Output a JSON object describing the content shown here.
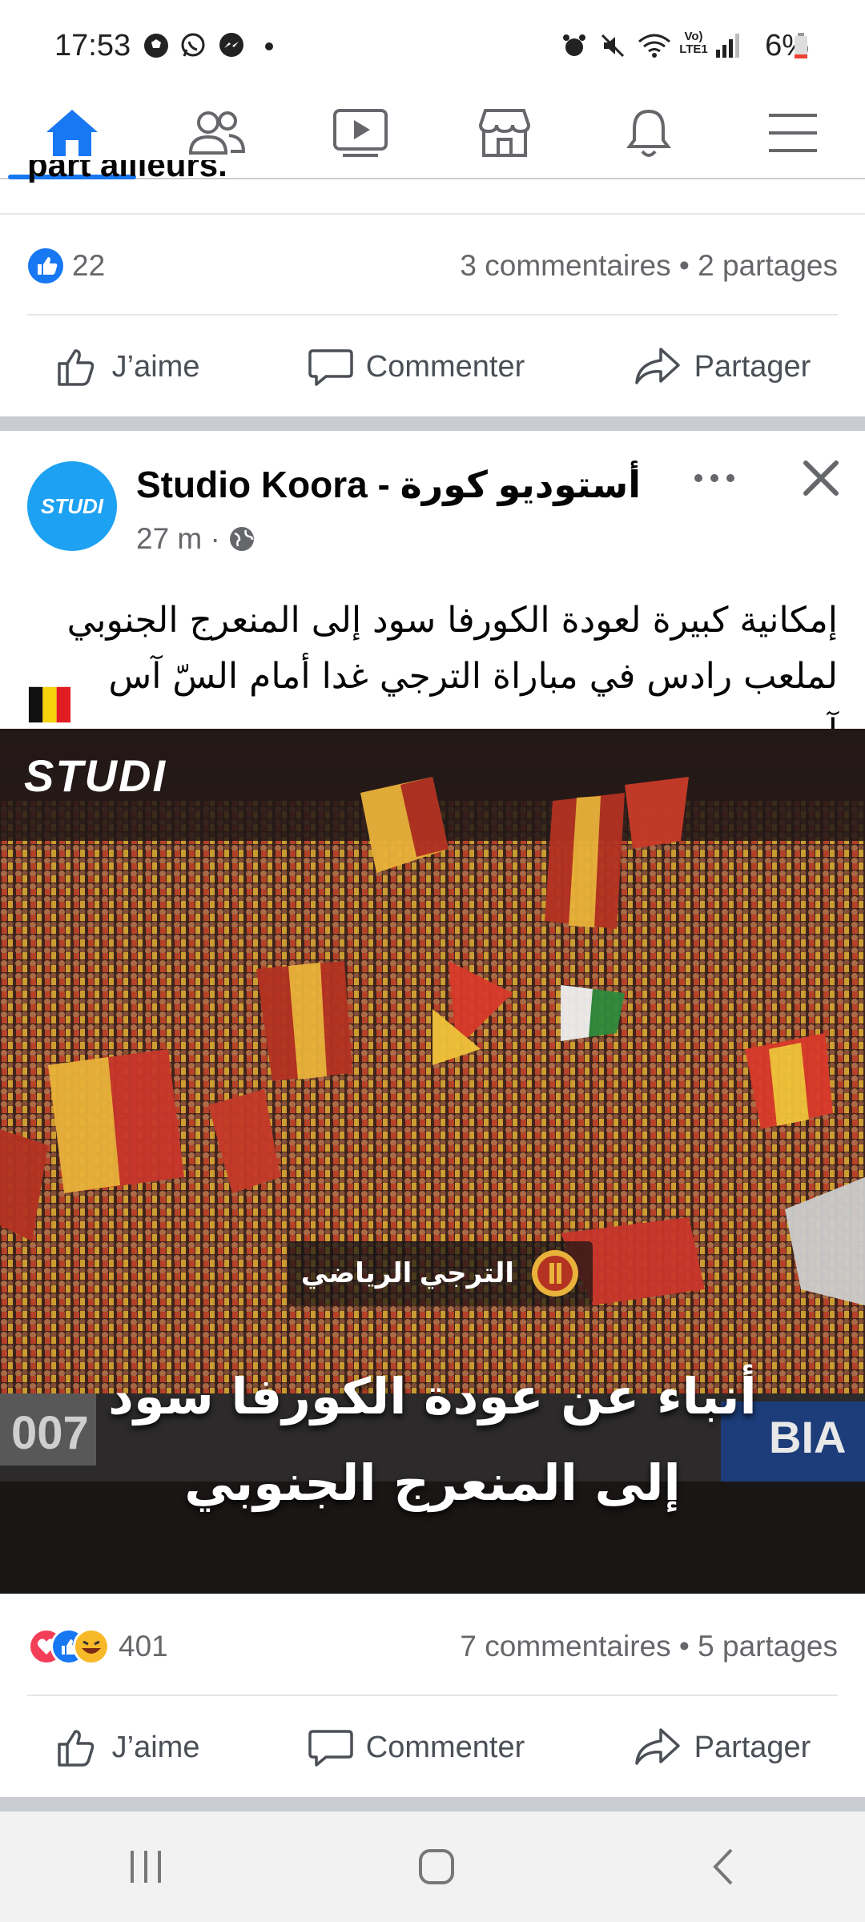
{
  "status_bar": {
    "time": "17:53",
    "battery": "6%",
    "left_icons": [
      "soccer-ball-icon",
      "whatsapp-icon",
      "messenger-icon",
      "dot-icon"
    ],
    "right_icons": [
      "alarm-icon",
      "mute-icon",
      "wifi-icon",
      "lte-icon",
      "signal-icon",
      "battery-icon"
    ],
    "lte_label": "Vo) LTE1"
  },
  "nav": {
    "items": [
      "home-icon",
      "friends-icon",
      "watch-icon",
      "marketplace-icon",
      "notifications-icon",
      "menu-icon"
    ],
    "active_color": "#1877f2"
  },
  "post1": {
    "cut_text": "part ailleurs.",
    "reaction_count": "22",
    "stats": "3 commentaires • 2 partages",
    "actions": {
      "like": "J’aime",
      "comment": "Commenter",
      "share": "Partager"
    }
  },
  "post2": {
    "page_name": "Studio Koora - أستوديو كورة",
    "avatar_text": "STUDI",
    "time": "27 m ·",
    "text_line1": "إمكانية كبيرة لعودة الكورفا سود إلى المنعرج الجنوبي",
    "text_line2": "لملعب رادس في مباراة الترجي غدا أمام السّ آس آس",
    "image": {
      "logo": "STUDI",
      "badge": "الترجي الرياضي",
      "headline_line1": "أنباء عن عودة الكورفا سود",
      "headline_line2": "إلى المنعرج الجنوبي",
      "banner_left": "007",
      "banner_right": "BIA"
    },
    "reaction_count": "401",
    "stats": "7 commentaires • 5 partages",
    "actions": {
      "like": "J’aime",
      "comment": "Commenter",
      "share": "Partager"
    }
  }
}
